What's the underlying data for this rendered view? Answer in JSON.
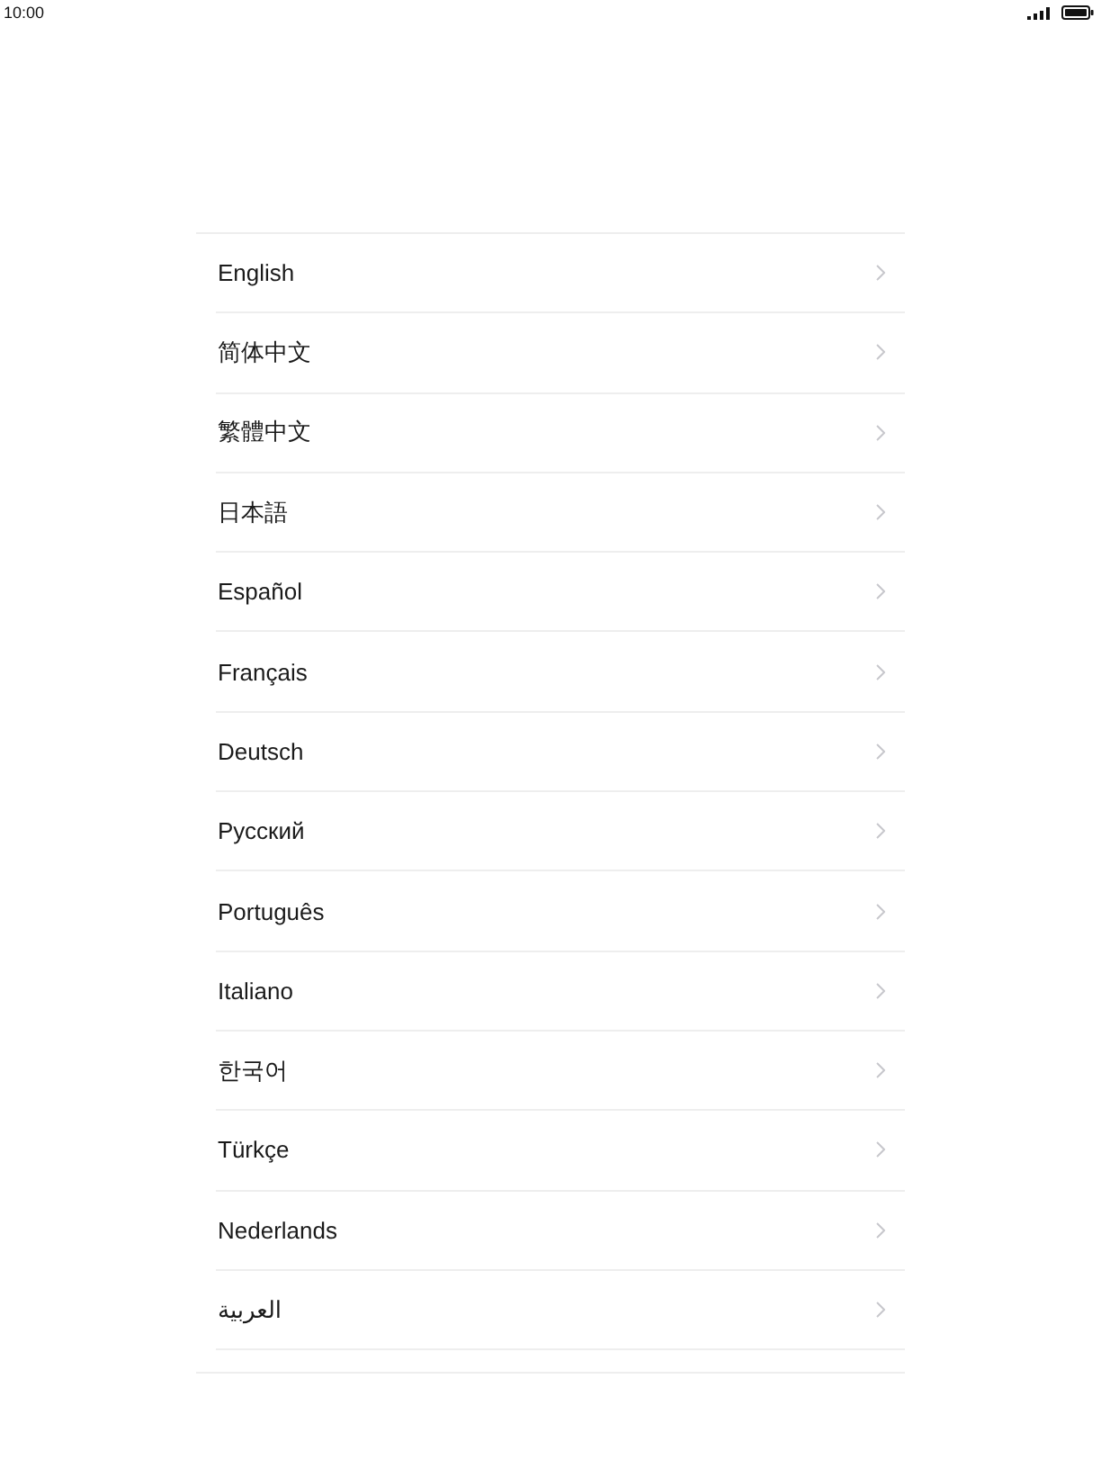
{
  "status_bar": {
    "time": "10:00"
  },
  "languages": [
    {
      "label": "English"
    },
    {
      "label": "简体中文"
    },
    {
      "label": "繁體中文"
    },
    {
      "label": "日本語"
    },
    {
      "label": "Español"
    },
    {
      "label": "Français"
    },
    {
      "label": "Deutsch"
    },
    {
      "label": "Русский"
    },
    {
      "label": "Português"
    },
    {
      "label": "Italiano"
    },
    {
      "label": "한국어"
    },
    {
      "label": "Türkçe"
    },
    {
      "label": "Nederlands"
    },
    {
      "label": "العربية"
    }
  ]
}
